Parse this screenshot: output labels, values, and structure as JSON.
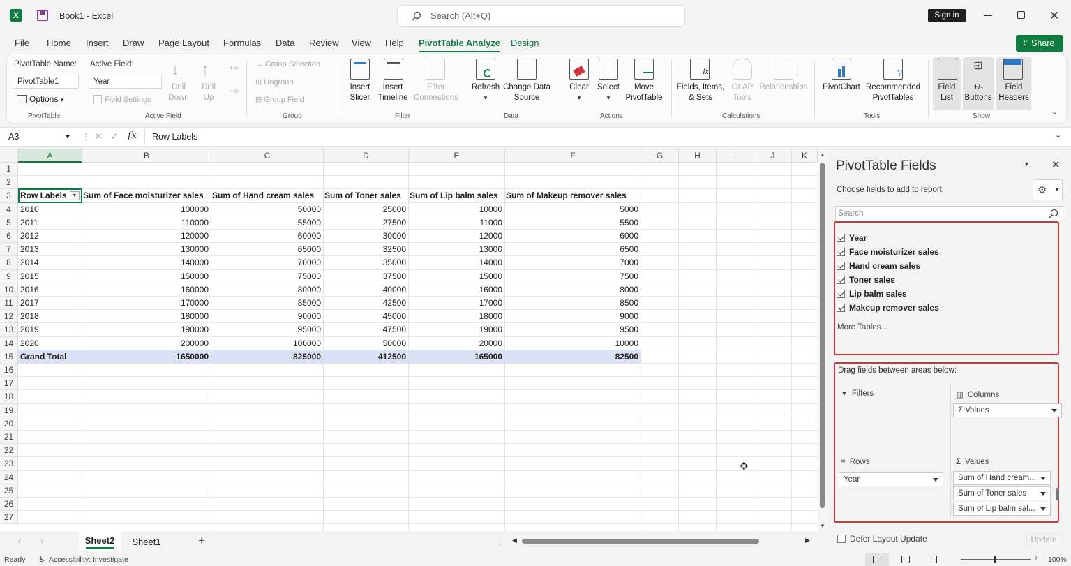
{
  "titlebar": {
    "doc_name": "Book1",
    "app_name": "Excel",
    "search_placeholder": "Search (Alt+Q)",
    "sign_in": "Sign in"
  },
  "menu": {
    "tabs": [
      "File",
      "Home",
      "Insert",
      "Draw",
      "Page Layout",
      "Formulas",
      "Data",
      "Review",
      "View",
      "Help",
      "PivotTable Analyze",
      "Design"
    ],
    "active_tab": "PivotTable Analyze",
    "share": "Share"
  },
  "ribbon": {
    "pivot_name_label": "PivotTable Name:",
    "pivot_name_value": "PivotTable1",
    "options": "Options",
    "group_pivottable": "PivotTable",
    "active_field_label": "Active Field:",
    "active_field_value": "Year",
    "field_settings": "Field Settings",
    "drill_down": "Drill Down",
    "drill_up": "Drill Up",
    "group_active_field": "Active Field",
    "group_selection": "Group Selection",
    "ungroup": "Ungroup",
    "group_field": "Group Field",
    "group_group": "Group",
    "insert_slicer": "Insert Slicer",
    "insert_timeline": "Insert Timeline",
    "filter_connections": "Filter Connections",
    "group_filter": "Filter",
    "refresh": "Refresh",
    "change_data_source": "Change Data Source",
    "group_data": "Data",
    "clear": "Clear",
    "select": "Select",
    "move_pivottable": "Move PivotTable",
    "group_actions": "Actions",
    "fields_items_sets": "Fields, Items, & Sets",
    "olap_tools": "OLAP Tools",
    "relationships": "Relationships",
    "group_calculations": "Calculations",
    "pivotchart": "PivotChart",
    "recommended_pivottables": "Recommended PivotTables",
    "group_tools": "Tools",
    "field_list": "Field List",
    "plus_minus_buttons": "+/- Buttons",
    "field_headers": "Field Headers",
    "group_show": "Show"
  },
  "formula_bar": {
    "name_box": "A3",
    "fx": "fx",
    "content": "Row Labels"
  },
  "columns": [
    "A",
    "B",
    "C",
    "D",
    "E",
    "F",
    "G",
    "H",
    "I",
    "J",
    "K"
  ],
  "rows": [
    "1",
    "2",
    "3",
    "4",
    "5",
    "6",
    "7",
    "8",
    "9",
    "10",
    "11",
    "12",
    "13",
    "14",
    "15",
    "16",
    "17",
    "18",
    "19",
    "20",
    "21",
    "22",
    "23",
    "24",
    "25",
    "26",
    "27"
  ],
  "pivot": {
    "headers": [
      "Row Labels",
      "Sum of Face moisturizer sales",
      "Sum of Hand cream sales",
      "Sum of Toner sales",
      "Sum of Lip balm sales",
      "Sum of Makeup remover sales"
    ],
    "rows": [
      [
        "2010",
        "100000",
        "50000",
        "25000",
        "10000",
        "5000"
      ],
      [
        "2011",
        "110000",
        "55000",
        "27500",
        "11000",
        "5500"
      ],
      [
        "2012",
        "120000",
        "60000",
        "30000",
        "12000",
        "6000"
      ],
      [
        "2013",
        "130000",
        "65000",
        "32500",
        "13000",
        "6500"
      ],
      [
        "2014",
        "140000",
        "70000",
        "35000",
        "14000",
        "7000"
      ],
      [
        "2015",
        "150000",
        "75000",
        "37500",
        "15000",
        "7500"
      ],
      [
        "2016",
        "160000",
        "80000",
        "40000",
        "16000",
        "8000"
      ],
      [
        "2017",
        "170000",
        "85000",
        "42500",
        "17000",
        "8500"
      ],
      [
        "2018",
        "180000",
        "90000",
        "45000",
        "18000",
        "9000"
      ],
      [
        "2019",
        "190000",
        "95000",
        "47500",
        "19000",
        "9500"
      ],
      [
        "2020",
        "200000",
        "100000",
        "50000",
        "20000",
        "10000"
      ]
    ],
    "total": [
      "Grand Total",
      "1650000",
      "825000",
      "412500",
      "165000",
      "82500"
    ]
  },
  "sheets": {
    "tabs": [
      "Sheet2",
      "Sheet1"
    ],
    "active": "Sheet2"
  },
  "status": {
    "ready": "Ready",
    "accessibility": "Accessibility: Investigate",
    "zoom": "100%"
  },
  "pane": {
    "title": "PivotTable Fields",
    "choose_label": "Choose fields to add to report:",
    "search_placeholder": "Search",
    "fields": [
      "Year",
      "Face moisturizer sales",
      "Hand cream sales",
      "Toner sales",
      "Lip balm sales",
      "Makeup remover sales"
    ],
    "more_tables": "More Tables...",
    "drag_label": "Drag fields between areas below:",
    "filters_label": "Filters",
    "columns_label": "Columns",
    "columns_item": "Values",
    "rows_label": "Rows",
    "rows_item": "Year",
    "values_label": "Values",
    "values_items": [
      "Sum of Hand cream...",
      "Sum of Toner sales",
      "Sum of Lip balm sal..."
    ],
    "defer_label": "Defer Layout Update",
    "update": "Update"
  },
  "colors": {
    "accent": "#0f7b3f",
    "highlight_box": "#d0343f",
    "total_row": "#d9e1f2"
  }
}
